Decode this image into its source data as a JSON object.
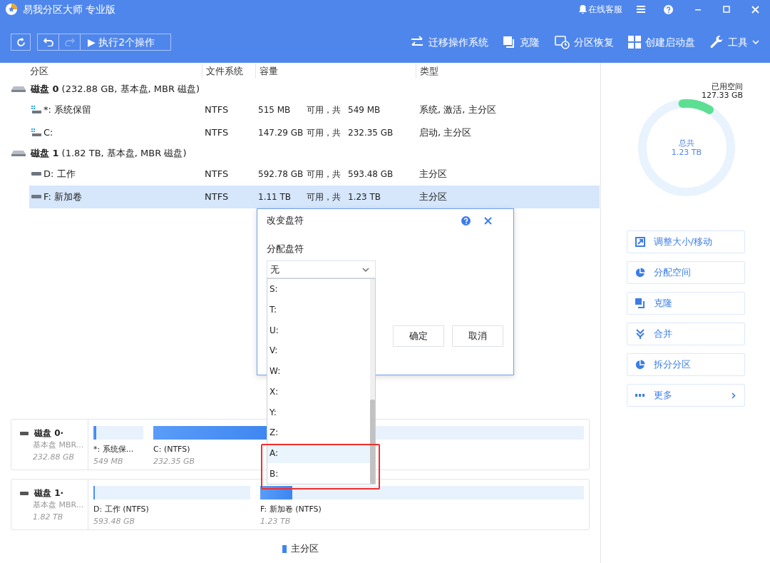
{
  "window": {
    "title": "易我分区大师 专业版",
    "support": "在线客服"
  },
  "toolbar": {
    "execute": "▶ 执行2个操作",
    "redo_disabled": true,
    "actions": [
      {
        "label": "迁移操作系统",
        "kind": "migrate"
      },
      {
        "label": "克隆",
        "kind": "clone"
      },
      {
        "label": "分区恢复",
        "kind": "recover"
      },
      {
        "label": "创建启动盘",
        "kind": "boot"
      },
      {
        "label": "工具",
        "kind": "tools"
      }
    ]
  },
  "table": {
    "columns": [
      "分区",
      "文件系统",
      "容量",
      "类型"
    ],
    "disks": [
      {
        "label": "磁盘 0",
        "info": "(232.88 GB, 基本盘, MBR 磁盘)",
        "partitions": [
          {
            "name": "*: 系统保留",
            "kind": "system",
            "fs": "NTFS",
            "free": "515 MB",
            "joiner": "可用，共",
            "total": "549 MB",
            "type": "系统, 激活, 主分区",
            "selected": false
          },
          {
            "name": "C:",
            "kind": "system",
            "fs": "NTFS",
            "free": "147.29 GB",
            "joiner": "可用，共",
            "total": "232.35 GB",
            "type": "启动, 主分区",
            "selected": false
          }
        ]
      },
      {
        "label": "磁盘 1",
        "info": "(1.82 TB, 基本盘, MBR 磁盘)",
        "partitions": [
          {
            "name": "D: 工作",
            "kind": "data",
            "fs": "NTFS",
            "free": "592.78 GB",
            "joiner": "可用，共",
            "total": "593.48 GB",
            "type": "主分区",
            "selected": false
          },
          {
            "name": "F: 新加卷",
            "kind": "data",
            "fs": "NTFS",
            "free": "1.11 TB",
            "joiner": "可用，共",
            "total": "1.23 TB",
            "type": "主分区",
            "selected": true
          }
        ]
      }
    ]
  },
  "disk_map": {
    "disks": [
      {
        "name": "磁盘 0·",
        "style": "基本盘 MBR...",
        "size": "232.88 GB",
        "partitions": [
          {
            "label": "*: 系统保...",
            "size": "549 MB",
            "level": 0.06
          },
          {
            "label": "C:  (NTFS)",
            "size": "232.35 GB",
            "level": 0.28
          }
        ]
      },
      {
        "name": "磁盘 1·",
        "style": "基本盘 MBR...",
        "size": "1.82 TB",
        "partitions": [
          {
            "label": "D: 工作 (NTFS)",
            "size": "593.48 GB",
            "level": 0.01
          },
          {
            "label": "F: 新加卷 (NTFS)",
            "size": "1.23 TB",
            "level": 0.1
          }
        ]
      }
    ],
    "legend": "主分区"
  },
  "usage": {
    "used_label": "已用空间",
    "used_value": "127.33 GB",
    "total_label": "总共",
    "total_value": "1.23 TB",
    "level": 0.1
  },
  "side_actions": [
    {
      "label": "调整大小/移动",
      "kind": "resize"
    },
    {
      "label": "分配空间",
      "kind": "pie"
    },
    {
      "label": "克隆",
      "kind": "clone"
    },
    {
      "label": "合并",
      "kind": "merge"
    },
    {
      "label": "拆分分区",
      "kind": "pie"
    },
    {
      "label": "更多",
      "kind": "more"
    }
  ],
  "dialog": {
    "title": "改变盘符",
    "field_label": "分配盘符",
    "value": "无",
    "ok": "确定",
    "cancel": "取消",
    "options": [
      {
        "label": "S:",
        "selected": false
      },
      {
        "label": "T:",
        "selected": false
      },
      {
        "label": "U:",
        "selected": false
      },
      {
        "label": "V:",
        "selected": false
      },
      {
        "label": "W:",
        "selected": false
      },
      {
        "label": "X:",
        "selected": false
      },
      {
        "label": "Y:",
        "selected": false
      },
      {
        "label": "Z:",
        "selected": false
      },
      {
        "label": "A:",
        "selected": true
      },
      {
        "label": "B:",
        "selected": false
      }
    ]
  }
}
